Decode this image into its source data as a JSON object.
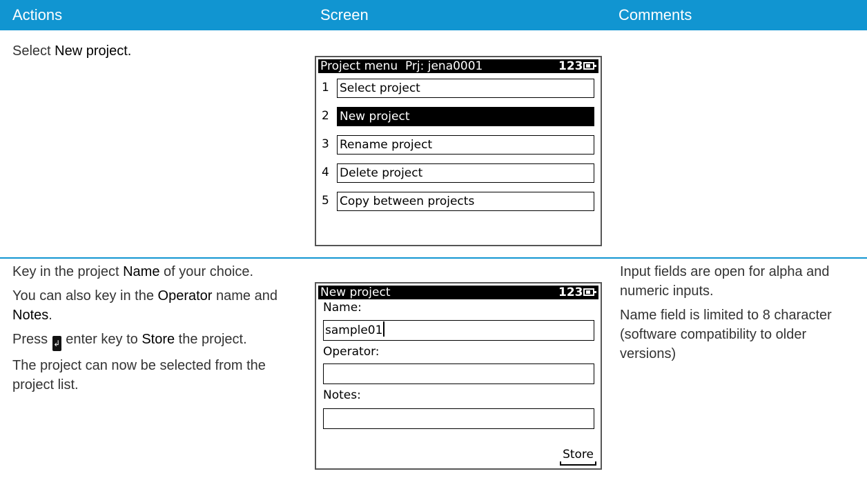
{
  "header": {
    "col1": "Actions",
    "col2": "Screen",
    "col3": "Comments"
  },
  "row1": {
    "action": {
      "t1": "Select ",
      "b1": "New project."
    },
    "screen": {
      "title": "Project menu  Prj: jena0001",
      "indicator": "123",
      "battery_icon": "battery-icon",
      "items": [
        {
          "num": "1",
          "label": "Select project"
        },
        {
          "num": "2",
          "label": "New project"
        },
        {
          "num": "3",
          "label": "Rename project"
        },
        {
          "num": "4",
          "label": "Delete project"
        },
        {
          "num": "5",
          "label": "Copy between projects"
        }
      ],
      "selected_index": 1
    }
  },
  "row2": {
    "actions": {
      "p1": {
        "t1": "Key in the project ",
        "b1": "Name",
        "t2": " of your choice."
      },
      "p2": {
        "t1": "You can also key in the ",
        "b1": "Operator",
        "t2": " name and ",
        "b2": "Notes",
        "t3": "."
      },
      "p3": {
        "t1": "Press ",
        "t2": " enter key to ",
        "b1": "Store",
        "t3": " the project."
      },
      "p4": "The project can now be selected from the project list."
    },
    "screen": {
      "title": "New project",
      "indicator": "123",
      "battery_icon": "battery-icon",
      "name_label": "Name:",
      "name_value": "sample01",
      "operator_label": "Operator:",
      "operator_value": "",
      "notes_label": "Notes:",
      "notes_value": "",
      "softkey": "Store"
    },
    "comments": {
      "c1": "Input fields are open for alpha and numeric inputs.",
      "c2": "Name field is limited to 8 character (software compatibility to older versions)"
    }
  },
  "colors": {
    "header_bg": "#1195d1",
    "text": "#333333",
    "screen_border": "#555555"
  }
}
